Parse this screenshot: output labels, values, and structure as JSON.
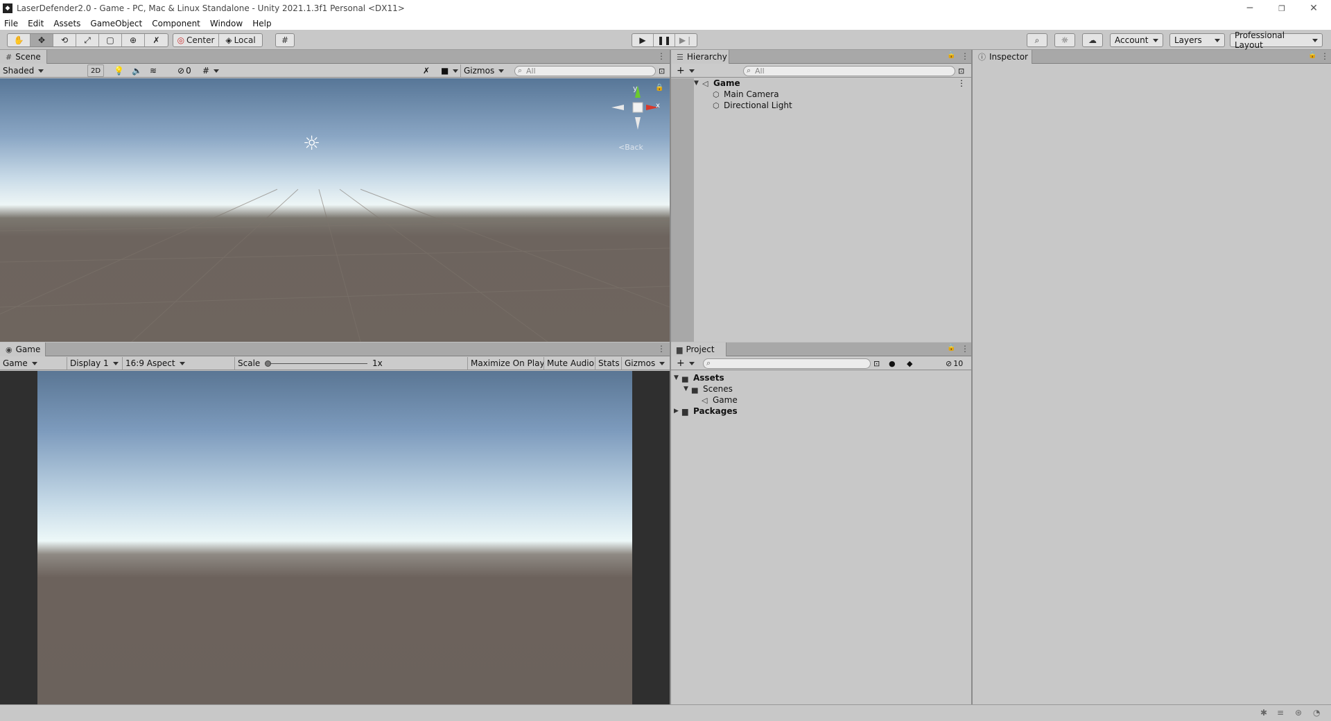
{
  "titlebar": {
    "title": "LaserDefender2.0 - Game - PC, Mac & Linux Standalone - Unity 2021.1.3f1 Personal <DX11>",
    "minimize": "─",
    "restore": "❐",
    "close": "✕"
  },
  "menu": [
    "File",
    "Edit",
    "Assets",
    "GameObject",
    "Component",
    "Window",
    "Help"
  ],
  "toolbar": {
    "center_label": "Center",
    "local_label": "Local",
    "account_label": "Account",
    "layers_label": "Layers",
    "layout_label": "Professional Layout"
  },
  "scene": {
    "tab_label": "Scene",
    "shading": "Shaded",
    "mode_2d": "2D",
    "hidden_count": "0",
    "gizmos_label": "Gizmos",
    "search_placeholder": "All",
    "axis_y": "y",
    "axis_x": "x",
    "back_label": "Back"
  },
  "game": {
    "tab_label": "Game",
    "mode": "Game",
    "display": "Display 1",
    "aspect": "16:9 Aspect",
    "scale_label": "Scale",
    "scale_value": "1x",
    "maximize": "Maximize On Play",
    "mute": "Mute Audio",
    "stats": "Stats",
    "gizmos": "Gizmos"
  },
  "hierarchy": {
    "tab_label": "Hierarchy",
    "search_placeholder": "All",
    "scene_name": "Game",
    "items": [
      "Main Camera",
      "Directional Light"
    ]
  },
  "project": {
    "tab_label": "Project",
    "hidden_count": "10",
    "tree": {
      "assets": "Assets",
      "scenes": "Scenes",
      "game_scene": "Game",
      "packages": "Packages"
    }
  },
  "inspector": {
    "tab_label": "Inspector"
  },
  "colors": {
    "panel": "#c8c8c8",
    "tabbar": "#a8a8a8",
    "axis_y": "#6bcb2d",
    "axis_x": "#d8382a"
  }
}
